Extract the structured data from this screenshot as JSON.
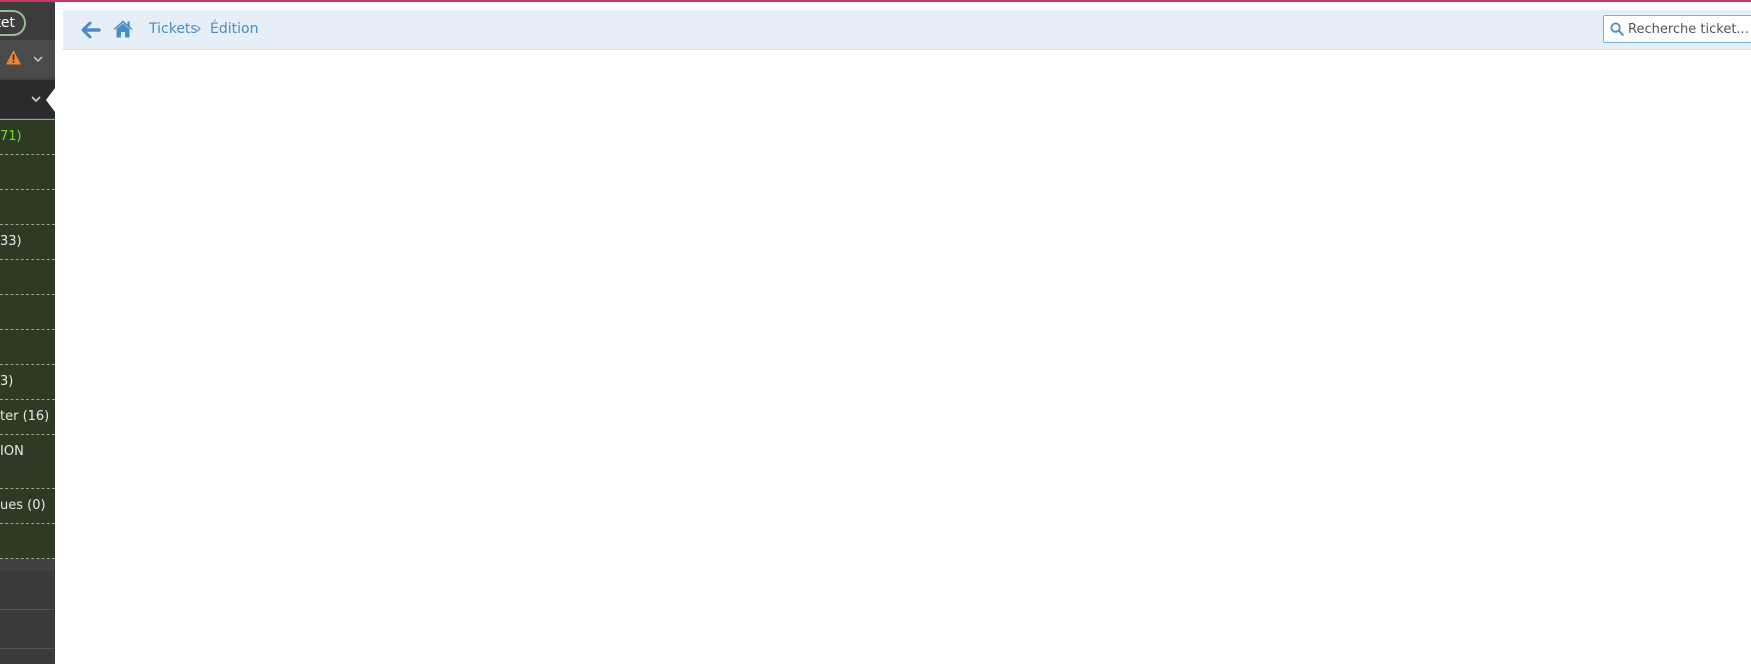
{
  "sidebar": {
    "new_ticket_label": "ket",
    "items": [
      {
        "label": "71)"
      },
      {
        "label": ""
      },
      {
        "label": ""
      },
      {
        "label": "33)"
      },
      {
        "label": ""
      },
      {
        "label": ""
      },
      {
        "label": ""
      },
      {
        "label": "3)"
      },
      {
        "label": "ter (16)"
      },
      {
        "label": "ION"
      },
      {
        "label": "ues (0)"
      },
      {
        "label": ""
      }
    ]
  },
  "breadcrumb": {
    "items": [
      {
        "label": "Tickets"
      },
      {
        "label": "Édition"
      }
    ],
    "separator": "›"
  },
  "search": {
    "placeholder": "Recherche ticket..."
  },
  "colors": {
    "accent": "#c03b5c",
    "link": "#4a8cc7",
    "sidebar_green": "#2d3a24",
    "highlight_green": "#77d82a",
    "warning": "#e8823a"
  },
  "icons": [
    "back-arrow-icon",
    "home-icon",
    "search-icon",
    "warning-icon",
    "chevron-down-icon"
  ]
}
